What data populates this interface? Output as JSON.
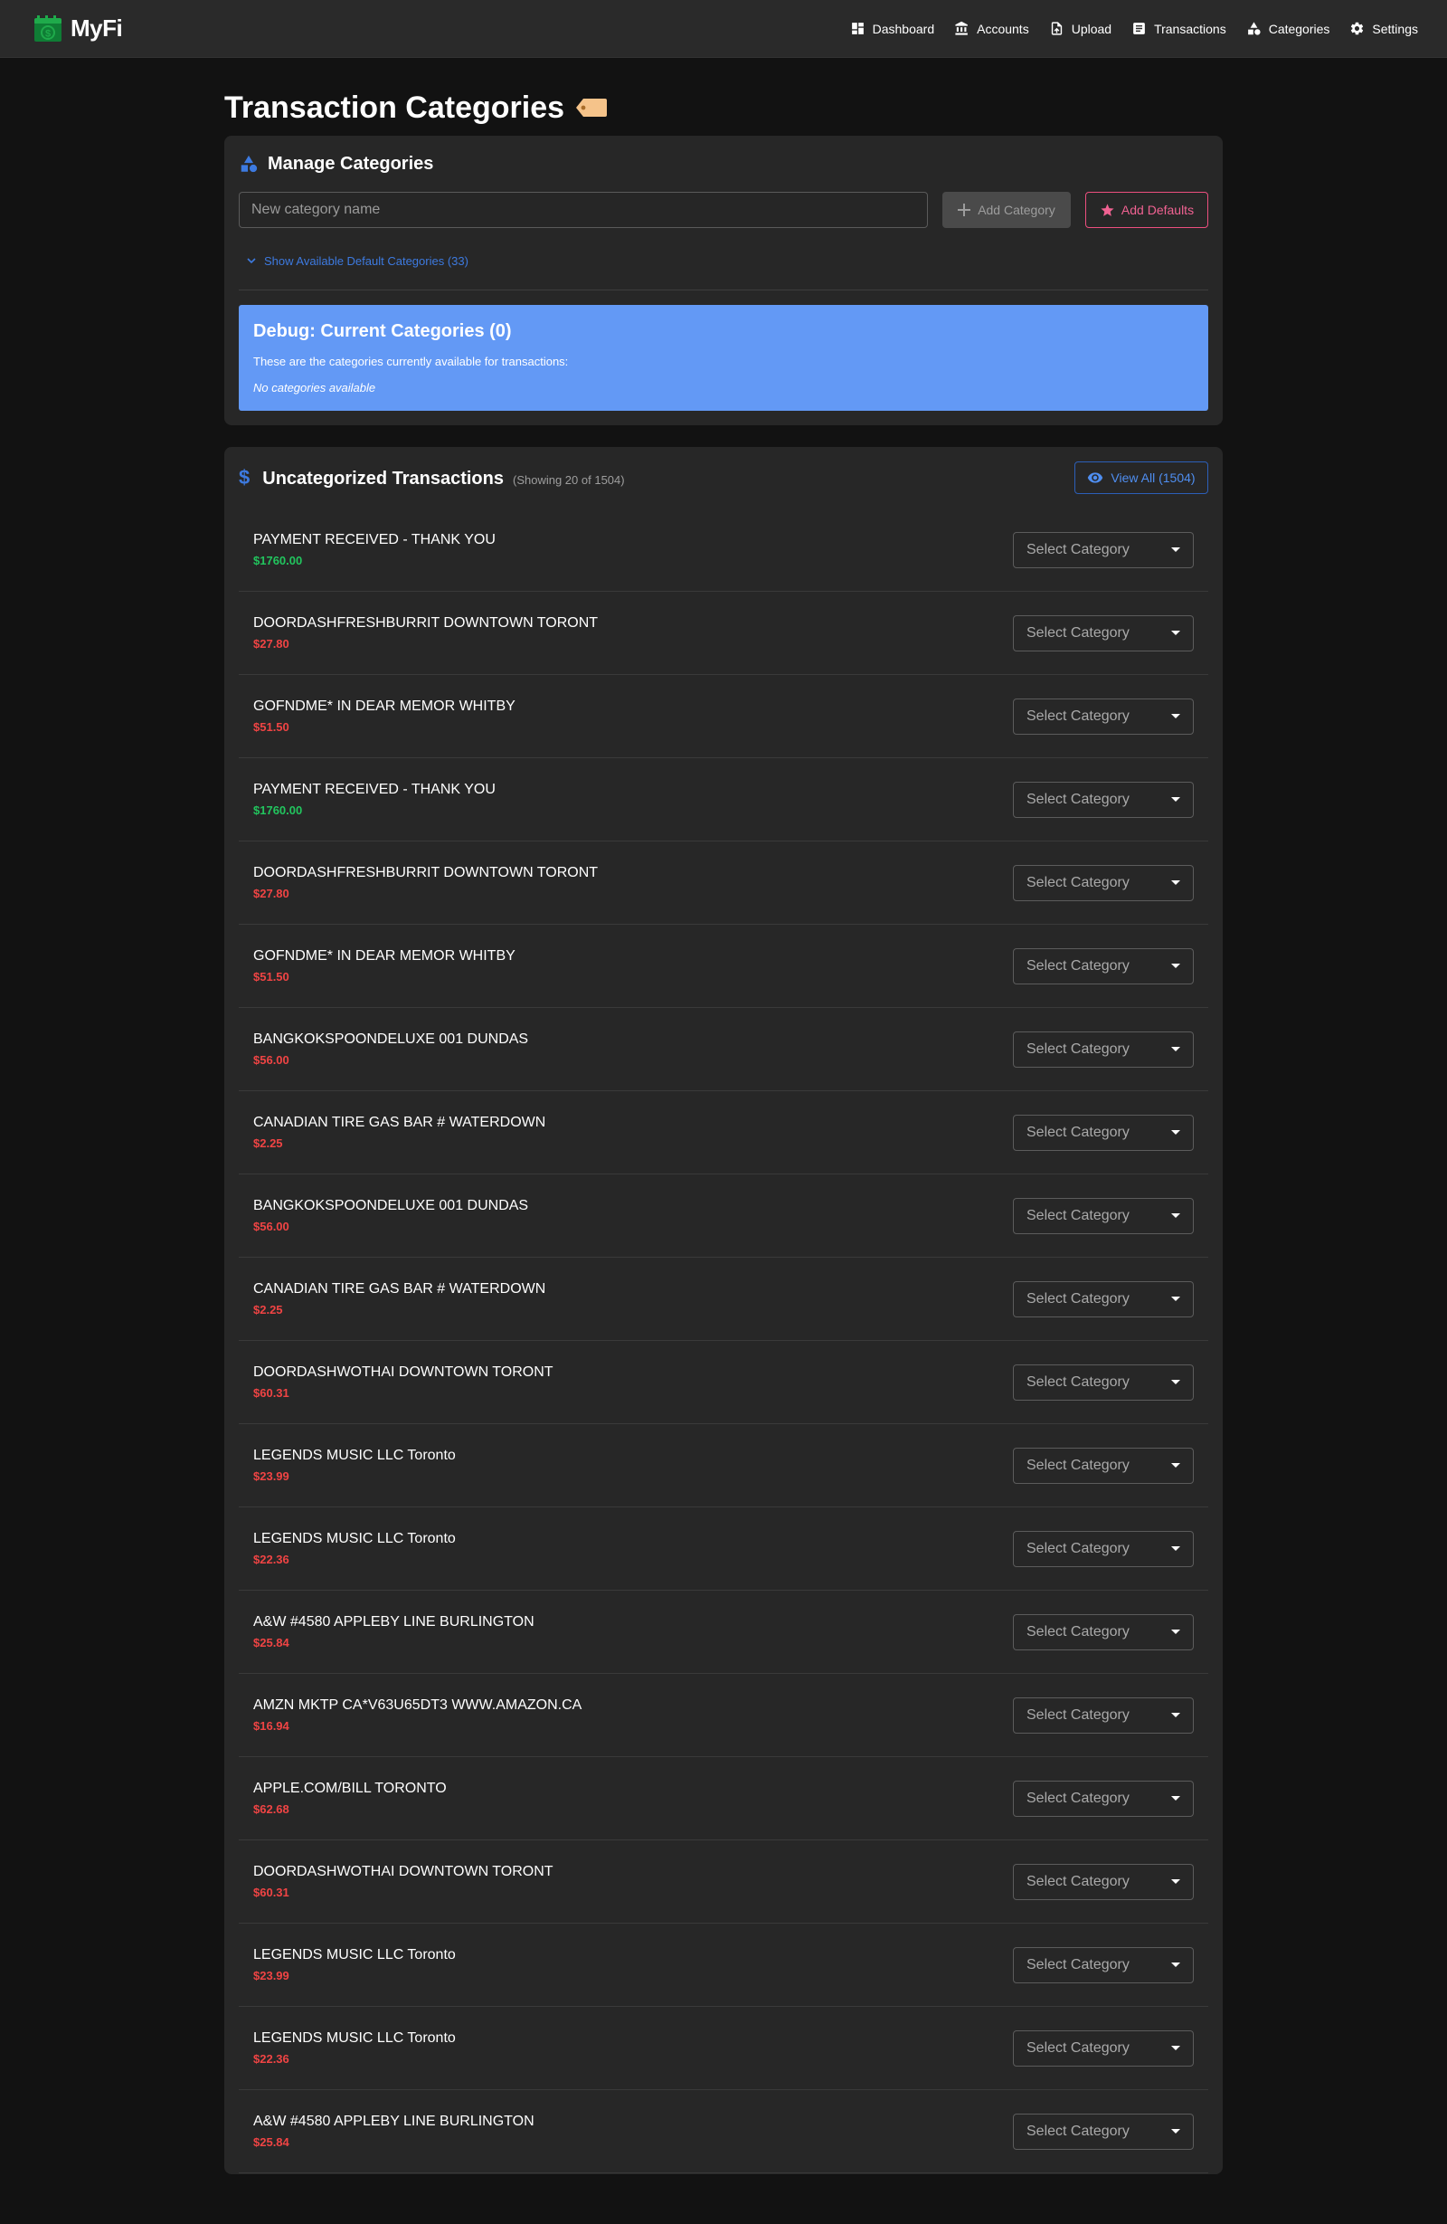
{
  "app": {
    "name": "MyFi"
  },
  "nav": [
    {
      "id": "dashboard",
      "label": "Dashboard",
      "icon": "dashboard-icon"
    },
    {
      "id": "accounts",
      "label": "Accounts",
      "icon": "bank-icon"
    },
    {
      "id": "upload",
      "label": "Upload",
      "icon": "upload-file-icon"
    },
    {
      "id": "transactions",
      "label": "Transactions",
      "icon": "list-icon"
    },
    {
      "id": "categories",
      "label": "Categories",
      "icon": "shapes-icon"
    },
    {
      "id": "settings",
      "label": "Settings",
      "icon": "gear-icon"
    }
  ],
  "page": {
    "title": "Transaction Categories",
    "title_icon": "tag-icon"
  },
  "manage": {
    "title": "Manage Categories",
    "input_placeholder": "New category name",
    "add_label": "Add Category",
    "defaults_label": "Add Defaults",
    "show_defaults": "Show Available Default Categories (33)"
  },
  "debug": {
    "title": "Debug: Current Categories (0)",
    "description": "These are the categories currently available for transactions:",
    "empty": "No categories available"
  },
  "uncategorized": {
    "title": "Uncategorized Transactions",
    "count": "(Showing 20 of 1504)",
    "view_all": "View All (1504)",
    "select_placeholder": "Select Category",
    "transactions": [
      {
        "description": "PAYMENT RECEIVED - THANK YOU",
        "amount": "$1760.00",
        "type": "credit"
      },
      {
        "description": "DOORDASHFRESHBURRIT DOWNTOWN TORONT",
        "amount": "$27.80",
        "type": "debit"
      },
      {
        "description": "GOFNDME* IN DEAR MEMOR WHITBY",
        "amount": "$51.50",
        "type": "debit"
      },
      {
        "description": "PAYMENT RECEIVED - THANK YOU",
        "amount": "$1760.00",
        "type": "credit"
      },
      {
        "description": "DOORDASHFRESHBURRIT DOWNTOWN TORONT",
        "amount": "$27.80",
        "type": "debit"
      },
      {
        "description": "GOFNDME* IN DEAR MEMOR WHITBY",
        "amount": "$51.50",
        "type": "debit"
      },
      {
        "description": "BANGKOKSPOONDELUXE 001 DUNDAS",
        "amount": "$56.00",
        "type": "debit"
      },
      {
        "description": "CANADIAN TIRE GAS BAR # WATERDOWN",
        "amount": "$2.25",
        "type": "debit"
      },
      {
        "description": "BANGKOKSPOONDELUXE 001 DUNDAS",
        "amount": "$56.00",
        "type": "debit"
      },
      {
        "description": "CANADIAN TIRE GAS BAR # WATERDOWN",
        "amount": "$2.25",
        "type": "debit"
      },
      {
        "description": "DOORDASHWOTHAI DOWNTOWN TORONT",
        "amount": "$60.31",
        "type": "debit"
      },
      {
        "description": "LEGENDS MUSIC LLC Toronto",
        "amount": "$23.99",
        "type": "debit"
      },
      {
        "description": "LEGENDS MUSIC LLC Toronto",
        "amount": "$22.36",
        "type": "debit"
      },
      {
        "description": "A&W #4580 APPLEBY LINE BURLINGTON",
        "amount": "$25.84",
        "type": "debit"
      },
      {
        "description": "AMZN MKTP CA*V63U65DT3 WWW.AMAZON.CA",
        "amount": "$16.94",
        "type": "debit"
      },
      {
        "description": "APPLE.COM/BILL TORONTO",
        "amount": "$62.68",
        "type": "debit"
      },
      {
        "description": "DOORDASHWOTHAI DOWNTOWN TORONT",
        "amount": "$60.31",
        "type": "debit"
      },
      {
        "description": "LEGENDS MUSIC LLC Toronto",
        "amount": "$23.99",
        "type": "debit"
      },
      {
        "description": "LEGENDS MUSIC LLC Toronto",
        "amount": "$22.36",
        "type": "debit"
      },
      {
        "description": "A&W #4580 APPLEBY LINE BURLINGTON",
        "amount": "$25.84",
        "type": "debit"
      }
    ]
  },
  "colors": {
    "brand_green": "#1faa4b",
    "accent_blue": "#3d7ae0",
    "accent_pink": "#f06292",
    "credit": "#22c55e",
    "debit": "#f04444",
    "debug_bg": "#6399f5"
  }
}
